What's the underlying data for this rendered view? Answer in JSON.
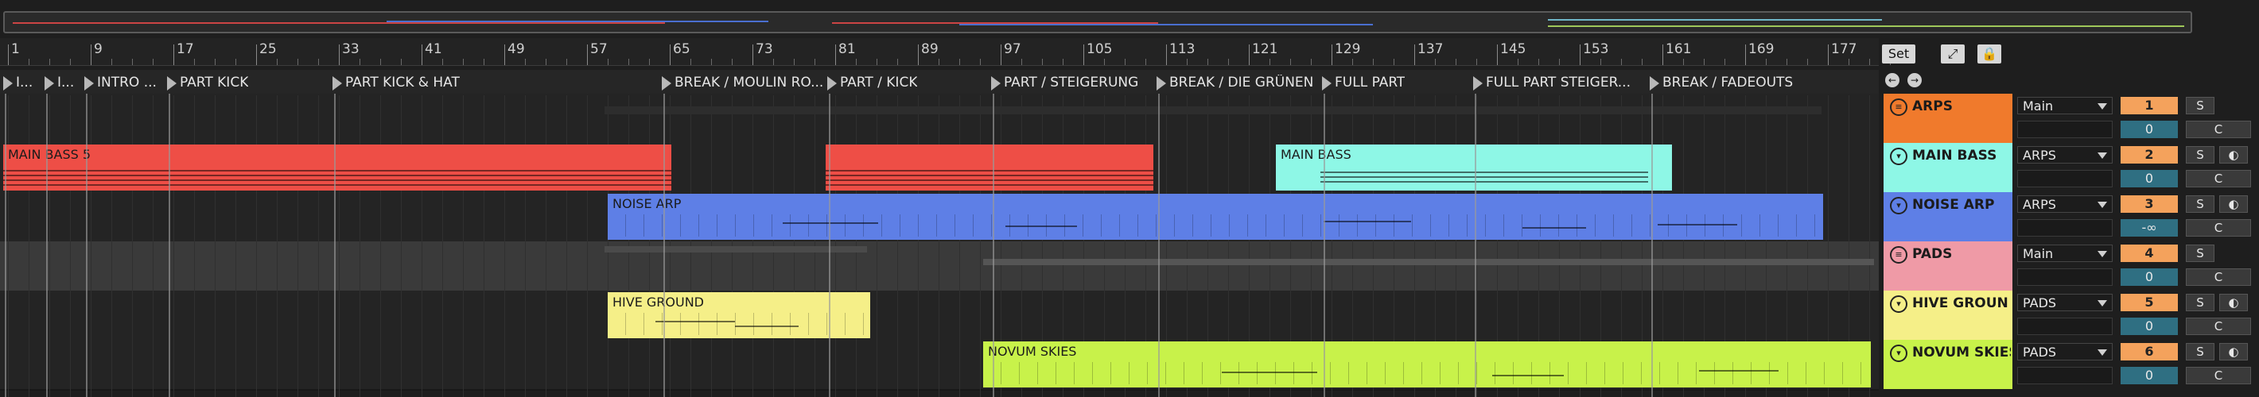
{
  "ruler": {
    "bars": [
      "1",
      "9",
      "17",
      "25",
      "33",
      "41",
      "49",
      "57",
      "65",
      "73",
      "81",
      "89",
      "97",
      "105",
      "113",
      "121",
      "129",
      "137",
      "145",
      "153",
      "161",
      "169",
      "177"
    ]
  },
  "locators": [
    {
      "label": "I..."
    },
    {
      "label": "I..."
    },
    {
      "label": "INTRO ..."
    },
    {
      "label": "PART KICK"
    },
    {
      "label": "PART KICK & HAT"
    },
    {
      "label": "BREAK / MOULIN RO..."
    },
    {
      "label": "PART / KICK"
    },
    {
      "label": "PART / STEIGERUNG"
    },
    {
      "label": "BREAK / DIE GRÜNEN"
    },
    {
      "label": "FULL PART"
    },
    {
      "label": "FULL PART STEIGER..."
    },
    {
      "label": "BREAK / FADEOUTS"
    }
  ],
  "controls": {
    "set_label": "Set",
    "resize_icon": "resize-icon",
    "lock_icon": "lock-icon",
    "back_icon": "arrow-left-icon",
    "forward_icon": "arrow-right-icon"
  },
  "clips": [
    {
      "name": "MAIN BASS 5",
      "color": "#ee4e46"
    },
    {
      "name": "",
      "color": "#ee4e46"
    },
    {
      "name": "MAIN BASS",
      "color": "#8ef7e6"
    },
    {
      "name": "NOISE ARP",
      "color": "#5e7fe6"
    },
    {
      "name": "HIVE GROUND",
      "color": "#f5ef88"
    },
    {
      "name": "NOVUM SKIES",
      "color": "#c8f24a"
    }
  ],
  "tracks": [
    {
      "name": "ARPS",
      "color": "#f07a2c",
      "fold_icon": "group-fold-icon",
      "route": "Main",
      "number": "1",
      "volume": "0",
      "solo": "S",
      "cue": "C",
      "has_record": false
    },
    {
      "name": "MAIN BASS",
      "color": "#8ef7e6",
      "fold_icon": "chevron-down-icon",
      "route": "ARPS",
      "number": "2",
      "volume": "0",
      "solo": "S",
      "cue": "C",
      "has_record": true
    },
    {
      "name": "NOISE ARP",
      "color": "#5e7fe6",
      "fold_icon": "chevron-down-icon",
      "route": "ARPS",
      "number": "3",
      "volume": "-∞",
      "solo": "S",
      "cue": "C",
      "has_record": true
    },
    {
      "name": "PADS",
      "color": "#ef9aa6",
      "fold_icon": "group-fold-icon",
      "route": "Main",
      "number": "4",
      "volume": "0",
      "solo": "S",
      "cue": "C",
      "has_record": false
    },
    {
      "name": "HIVE GROUN",
      "color": "#f5ef88",
      "fold_icon": "chevron-down-icon",
      "route": "PADS",
      "number": "5",
      "volume": "0",
      "solo": "S",
      "cue": "C",
      "has_record": true
    },
    {
      "name": "NOVUM SKIES",
      "color": "#c8f24a",
      "fold_icon": "chevron-down-icon",
      "route": "PADS",
      "number": "6",
      "volume": "0",
      "solo": "S",
      "cue": "C",
      "has_record": true
    }
  ]
}
